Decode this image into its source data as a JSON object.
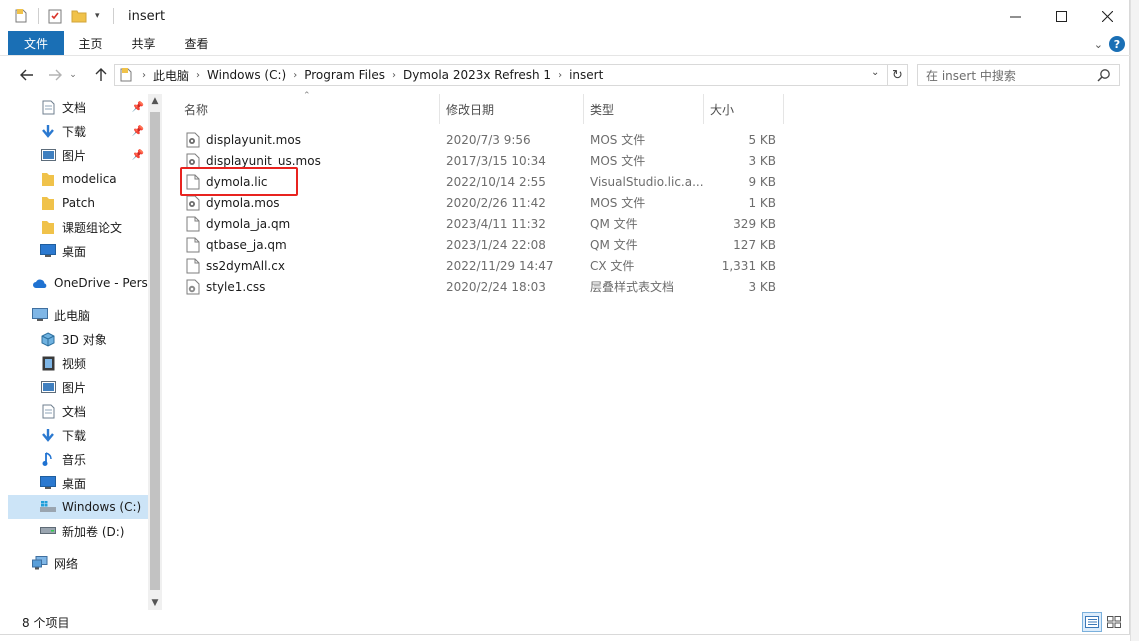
{
  "window": {
    "title": "insert",
    "controls": {
      "minimize": "—",
      "maximize": "☐",
      "close": "✕"
    }
  },
  "ribbon": {
    "file_tab": "文件",
    "tabs": [
      "主页",
      "共享",
      "查看"
    ],
    "help_icon": "?"
  },
  "address": {
    "crumbs": [
      "此电脑",
      "Windows (C:)",
      "Program Files",
      "Dymola 2023x Refresh 1",
      "insert"
    ],
    "search_placeholder": "在 insert 中搜索"
  },
  "navigation": {
    "quick_access": [
      {
        "label": "文档",
        "icon": "document-icon",
        "pinned": true
      },
      {
        "label": "下载",
        "icon": "download-icon",
        "pinned": true
      },
      {
        "label": "图片",
        "icon": "pictures-icon",
        "pinned": true
      },
      {
        "label": "modelica",
        "icon": "folder-icon",
        "pinned": false
      },
      {
        "label": "Patch",
        "icon": "folder-icon",
        "pinned": false
      },
      {
        "label": "课题组论文",
        "icon": "folder-icon",
        "pinned": false
      },
      {
        "label": "桌面",
        "icon": "desktop-icon",
        "pinned": false
      }
    ],
    "onedrive": "OneDrive - Perso",
    "this_pc": "此电脑",
    "this_pc_items": [
      {
        "label": "3D 对象",
        "icon": "3d-objects-icon"
      },
      {
        "label": "视频",
        "icon": "video-icon"
      },
      {
        "label": "图片",
        "icon": "pictures-icon"
      },
      {
        "label": "文档",
        "icon": "document-icon"
      },
      {
        "label": "下载",
        "icon": "download-icon"
      },
      {
        "label": "音乐",
        "icon": "music-icon"
      },
      {
        "label": "桌面",
        "icon": "desktop-icon"
      },
      {
        "label": "Windows (C:)",
        "icon": "windows-drive-icon",
        "selected": true
      },
      {
        "label": "新加卷 (D:)",
        "icon": "drive-icon"
      }
    ],
    "network": "网络"
  },
  "columns": {
    "name": "名称",
    "modified": "修改日期",
    "type": "类型",
    "size": "大小"
  },
  "files": [
    {
      "name": "displayunit.mos",
      "modified": "2020/7/3 9:56",
      "type": "MOS 文件",
      "size": "5 KB",
      "icon": "script-file-icon"
    },
    {
      "name": "displayunit_us.mos",
      "modified": "2017/3/15 10:34",
      "type": "MOS 文件",
      "size": "3 KB",
      "icon": "script-file-icon"
    },
    {
      "name": "dymola.lic",
      "modified": "2022/10/14 2:55",
      "type": "VisualStudio.lic.a...",
      "size": "9 KB",
      "icon": "blank-file-icon",
      "highlighted": true
    },
    {
      "name": "dymola.mos",
      "modified": "2020/2/26 11:42",
      "type": "MOS 文件",
      "size": "1 KB",
      "icon": "script-file-icon"
    },
    {
      "name": "dymola_ja.qm",
      "modified": "2023/4/11 11:32",
      "type": "QM 文件",
      "size": "329 KB",
      "icon": "blank-file-icon"
    },
    {
      "name": "qtbase_ja.qm",
      "modified": "2023/1/24 22:08",
      "type": "QM 文件",
      "size": "127 KB",
      "icon": "blank-file-icon"
    },
    {
      "name": "ss2dymAll.cx",
      "modified": "2022/11/29 14:47",
      "type": "CX 文件",
      "size": "1,331 KB",
      "icon": "blank-file-icon"
    },
    {
      "name": "style1.css",
      "modified": "2020/2/24 18:03",
      "type": "层叠样式表文档",
      "size": "3 KB",
      "icon": "stylesheet-file-icon"
    }
  ],
  "status": {
    "item_count": "8 个项目"
  },
  "colors": {
    "accent": "#1a6fb5",
    "selection": "#cce4f7",
    "highlight_border": "#e8231f",
    "folder": "#f0c24a"
  }
}
